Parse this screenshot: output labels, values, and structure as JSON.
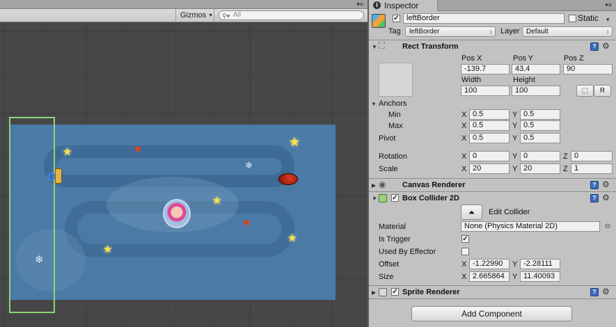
{
  "scene": {
    "gizmos_label": "Gizmos",
    "search_placeholder": "All"
  },
  "inspector": {
    "tab_label": "Inspector",
    "object": {
      "name": "leftBorder",
      "active": true,
      "static_label": "Static",
      "static_checked": false,
      "tag_label": "Tag",
      "tag_value": "leftBorder",
      "layer_label": "Layer",
      "layer_value": "Default"
    },
    "rect_transform": {
      "title": "Rect Transform",
      "pos_x_label": "Pos X",
      "pos_y_label": "Pos Y",
      "pos_z_label": "Pos Z",
      "pos_x": "-139.7",
      "pos_y": "43.4",
      "pos_z": "90",
      "width_label": "Width",
      "height_label": "Height",
      "width": "100",
      "height": "100",
      "raw_edit_label": "R",
      "anchors_label": "Anchors",
      "min_label": "Min",
      "max_label": "Max",
      "min_x": "0.5",
      "min_y": "0.5",
      "max_x": "0.5",
      "max_y": "0.5",
      "pivot_label": "Pivot",
      "pivot_x": "0.5",
      "pivot_y": "0.5",
      "rotation_label": "Rotation",
      "rot_x": "0",
      "rot_y": "0",
      "rot_z": "0",
      "scale_label": "Scale",
      "scale_x": "20",
      "scale_y": "20",
      "scale_z": "1",
      "x_label": "X",
      "y_label": "Y",
      "z_label": "Z"
    },
    "canvas_renderer": {
      "title": "Canvas Renderer"
    },
    "box_collider": {
      "title": "Box Collider 2D",
      "enabled": true,
      "edit_collider_label": "Edit Collider",
      "material_label": "Material",
      "material_value": "None (Physics Material 2D)",
      "is_trigger_label": "Is Trigger",
      "is_trigger": true,
      "used_by_effector_label": "Used By Effector",
      "used_by_effector": false,
      "offset_label": "Offset",
      "offset_x": "-1.22990",
      "offset_y": "-2.28111",
      "size_label": "Size",
      "size_x": "2.665864",
      "size_y": "11.40093"
    },
    "sprite_renderer": {
      "title": "Sprite Renderer",
      "enabled": true
    },
    "add_component_label": "Add Component"
  }
}
